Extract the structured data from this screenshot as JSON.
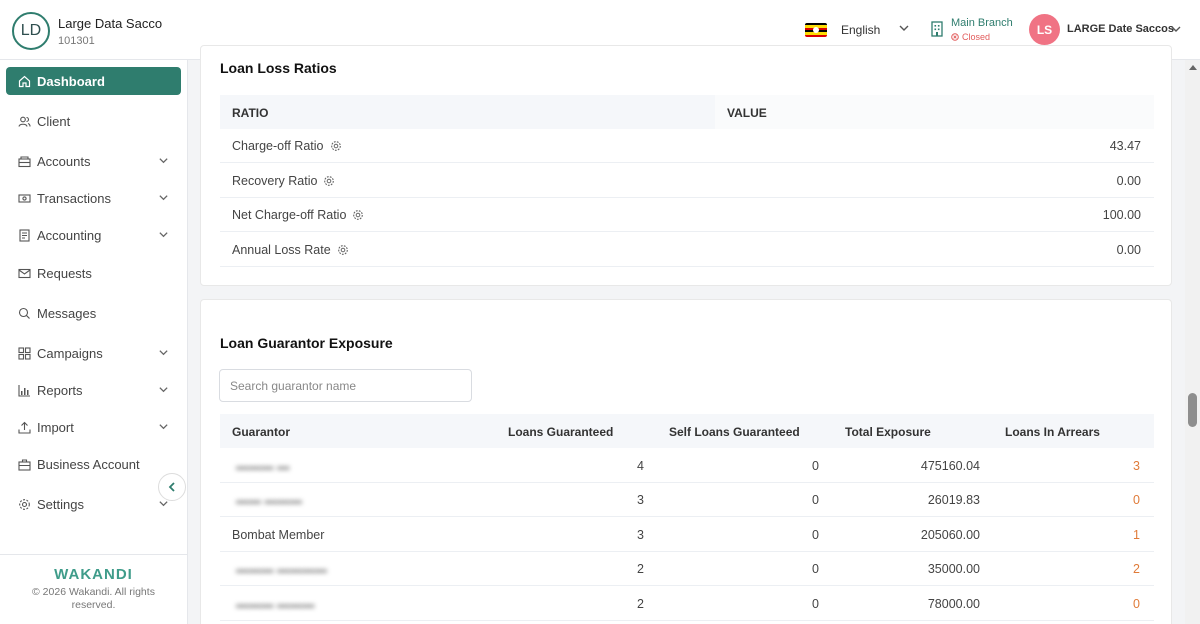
{
  "org": {
    "initials": "LD",
    "name": "Large Data Sacco",
    "code": "101301"
  },
  "header": {
    "language": "English",
    "branch_name": "Main Branch",
    "branch_status": "Closed",
    "user_initials": "LS",
    "user_name": "LARGE Date Saccos"
  },
  "colors": {
    "primary": "#2f7d6e",
    "avatar": "#f07384",
    "arrears": "#e07b39",
    "closed": "#e25c5c"
  },
  "sidebar": {
    "items": [
      {
        "label": "Dashboard",
        "icon": "home-icon",
        "active": true
      },
      {
        "label": "Client",
        "icon": "users-icon"
      },
      {
        "label": "Accounts",
        "icon": "bank-icon",
        "expandable": true
      },
      {
        "label": "Transactions",
        "icon": "cash-icon",
        "expandable": true
      },
      {
        "label": "Accounting",
        "icon": "ledger-icon",
        "expandable": true
      },
      {
        "label": "Requests",
        "icon": "mail-icon"
      },
      {
        "label": "Messages",
        "icon": "chat-icon"
      },
      {
        "label": "Campaigns",
        "icon": "grid-icon",
        "expandable": true
      },
      {
        "label": "Reports",
        "icon": "bar-chart-icon",
        "expandable": true
      },
      {
        "label": "Import",
        "icon": "upload-icon",
        "expandable": true
      },
      {
        "label": "Business Account",
        "icon": "briefcase-icon"
      },
      {
        "label": "Settings",
        "icon": "gear-icon",
        "expandable": true
      }
    ],
    "brand": "WAKANDI",
    "copyright": "© 2026 Wakandi. All rights reserved."
  },
  "loan_loss": {
    "title": "Loan Loss Ratios",
    "headers": {
      "ratio": "RATIO",
      "value": "VALUE"
    },
    "rows": [
      {
        "label": "Charge-off Ratio",
        "value": "43.47"
      },
      {
        "label": "Recovery Ratio",
        "value": "0.00"
      },
      {
        "label": "Net Charge-off Ratio",
        "value": "100.00"
      },
      {
        "label": "Annual Loss Rate",
        "value": "0.00"
      }
    ]
  },
  "guarantor": {
    "title": "Loan Guarantor Exposure",
    "search_placeholder": "Search guarantor name",
    "headers": {
      "guarantor": "Guarantor",
      "loans_guaranteed": "Loans Guaranteed",
      "self_loans": "Self Loans Guaranteed",
      "total_exposure": "Total Exposure",
      "loans_in_arrears": "Loans In Arrears"
    },
    "rows": [
      {
        "name": "",
        "blurred": true,
        "loans": "4",
        "self": "0",
        "exposure": "475160.04",
        "arrears": "3"
      },
      {
        "name": "",
        "blurred": true,
        "loans": "3",
        "self": "0",
        "exposure": "26019.83",
        "arrears": "0"
      },
      {
        "name": "Bombat Member",
        "blurred": false,
        "loans": "3",
        "self": "0",
        "exposure": "205060.00",
        "arrears": "1"
      },
      {
        "name": "",
        "blurred": true,
        "loans": "2",
        "self": "0",
        "exposure": "35000.00",
        "arrears": "2"
      },
      {
        "name": "",
        "blurred": true,
        "loans": "2",
        "self": "0",
        "exposure": "78000.00",
        "arrears": "0"
      }
    ]
  }
}
